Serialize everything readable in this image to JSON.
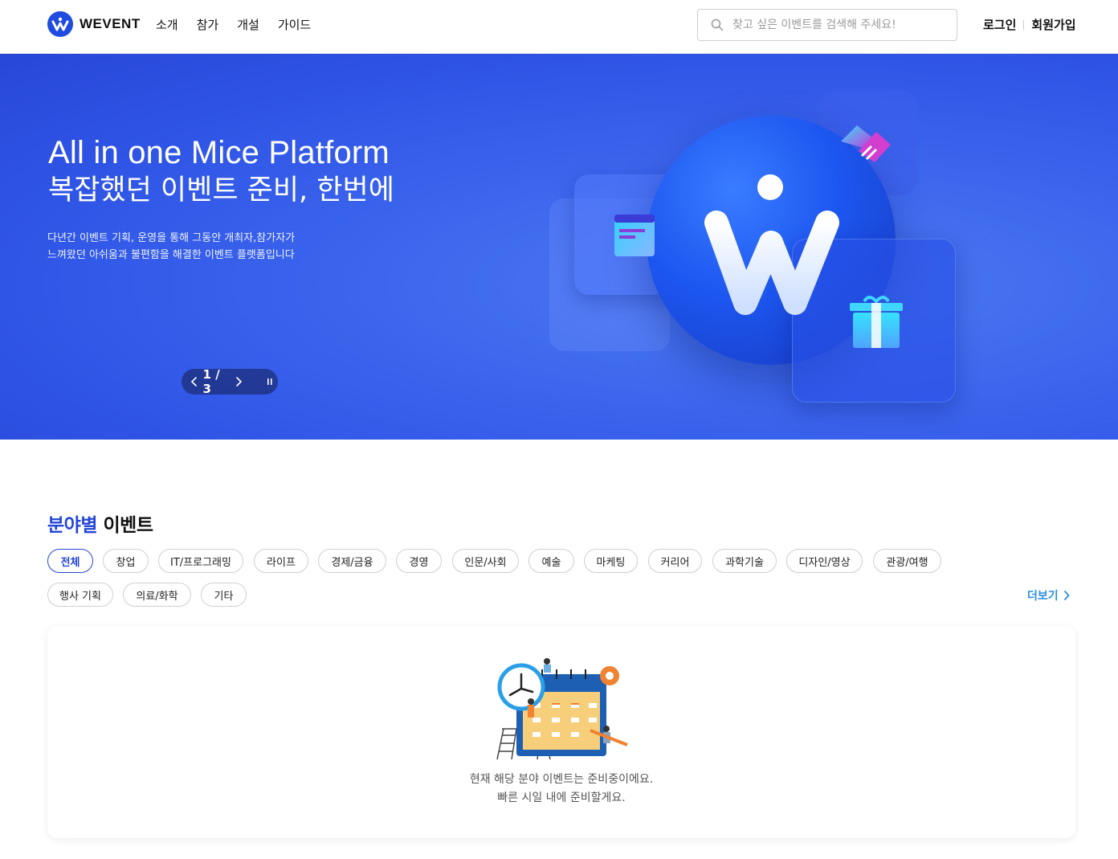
{
  "header": {
    "logo_text": "WEVENT",
    "nav": [
      "소개",
      "참가",
      "개설",
      "가이드"
    ],
    "search_placeholder": "찾고 싶은 이벤트를 검색해 주세요!",
    "login": "로그인",
    "signup": "회원가입"
  },
  "hero": {
    "title_en": "All in one Mice Platform",
    "title_ko": "복잡했던 이벤트 준비, 한번에",
    "desc_line1": "다년간 이벤트 기획, 운영을 통해 그동안 개최자,참가자가",
    "desc_line2": "느껴왔던 아쉬움과 불편함을 해결한 이벤트 플랫폼입니다",
    "slide_counter": "1 / 3"
  },
  "section": {
    "title_highlight": "분야별",
    "title_rest": "이벤트",
    "categories": [
      "전체",
      "창업",
      "IT/프로그래밍",
      "라이프",
      "경제/금융",
      "경영",
      "인문/사회",
      "예술",
      "마케팅",
      "커리어",
      "과학기술",
      "디자인/영상",
      "관광/여행",
      "행사 기획",
      "의료/화학",
      "기타"
    ],
    "active_category": "전체",
    "more": "더보기",
    "empty_line1": "현재 해당 분야 이벤트는 준비중이에요.",
    "empty_line2": "빠른 시일 내에 준비할게요."
  },
  "colors": {
    "brand": "#1f4be0",
    "hero_bg": "#2f55e6",
    "accent_link": "#2a8fe0"
  },
  "icons": [
    "logo-icon",
    "search-icon",
    "chevron-left-icon",
    "chevron-right-icon",
    "pause-icon"
  ]
}
